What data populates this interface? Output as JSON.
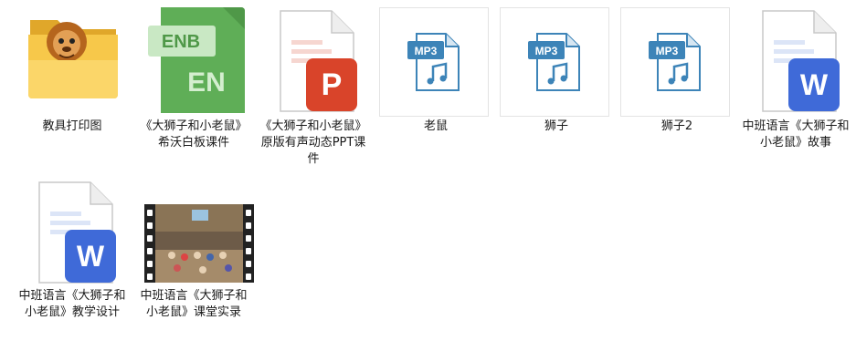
{
  "files": [
    {
      "name": "教具打印图",
      "icon": "folder-icon"
    },
    {
      "name": "《大狮子和小老鼠》希沃白板课件",
      "icon": "enb-icon",
      "badge1": "ENB",
      "badge2": "EN"
    },
    {
      "name": "《大狮子和小老鼠》原版有声动态PPT课件",
      "icon": "ppt-icon",
      "badge": "P"
    },
    {
      "name": "老鼠",
      "icon": "mp3-icon",
      "badge": "MP3"
    },
    {
      "name": "狮子",
      "icon": "mp3-icon",
      "badge": "MP3"
    },
    {
      "name": "狮子2",
      "icon": "mp3-icon",
      "badge": "MP3"
    },
    {
      "name": "中班语言《大狮子和小老鼠》故事",
      "icon": "word-icon",
      "badge": "W"
    },
    {
      "name": "中班语言《大狮子和小老鼠》教学设计",
      "icon": "word-icon",
      "badge": "W"
    },
    {
      "name": "中班语言《大狮子和小老鼠》课堂实录",
      "icon": "video-icon"
    }
  ],
  "colors": {
    "folder": "#f5c542",
    "enb": "#5fae57",
    "ppt": "#d9442a",
    "mp3": "#3d84b8",
    "word": "#3f6ad8"
  }
}
